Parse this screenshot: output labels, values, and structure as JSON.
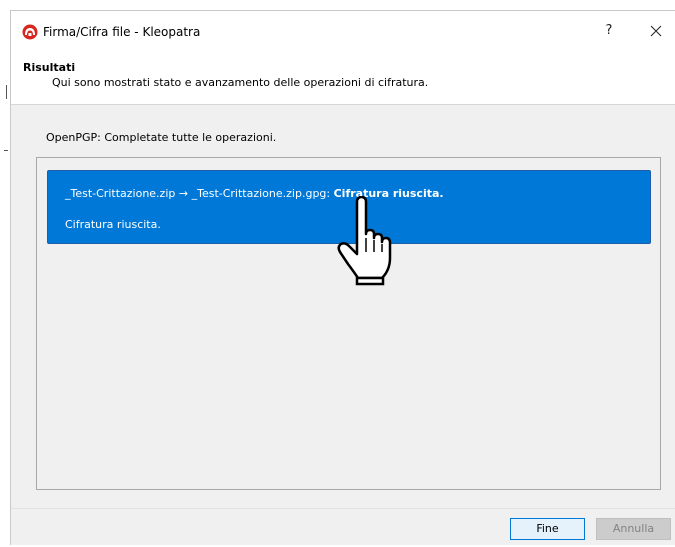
{
  "window": {
    "title": "Firma/Cifra file - Kleopatra",
    "help_label": "?",
    "close_icon": "close-icon"
  },
  "header": {
    "title": "Risultati",
    "subtitle": "Qui sono mostrati stato e avanzamento delle operazioni di cifratura."
  },
  "status": {
    "text": "OpenPGP: Completate tutte le operazioni."
  },
  "results": [
    {
      "source_file": "_Test-Crittazione.zip",
      "arrow": "→",
      "target_file": "_Test-Crittazione.zip.gpg:",
      "result_bold": "Cifratura riuscita.",
      "detail": "Cifratura riuscita."
    }
  ],
  "buttons": {
    "finish": "Fine",
    "cancel": "Annulla"
  },
  "colors": {
    "selection": "#0078d7",
    "brand_icon": "#d7261e"
  }
}
